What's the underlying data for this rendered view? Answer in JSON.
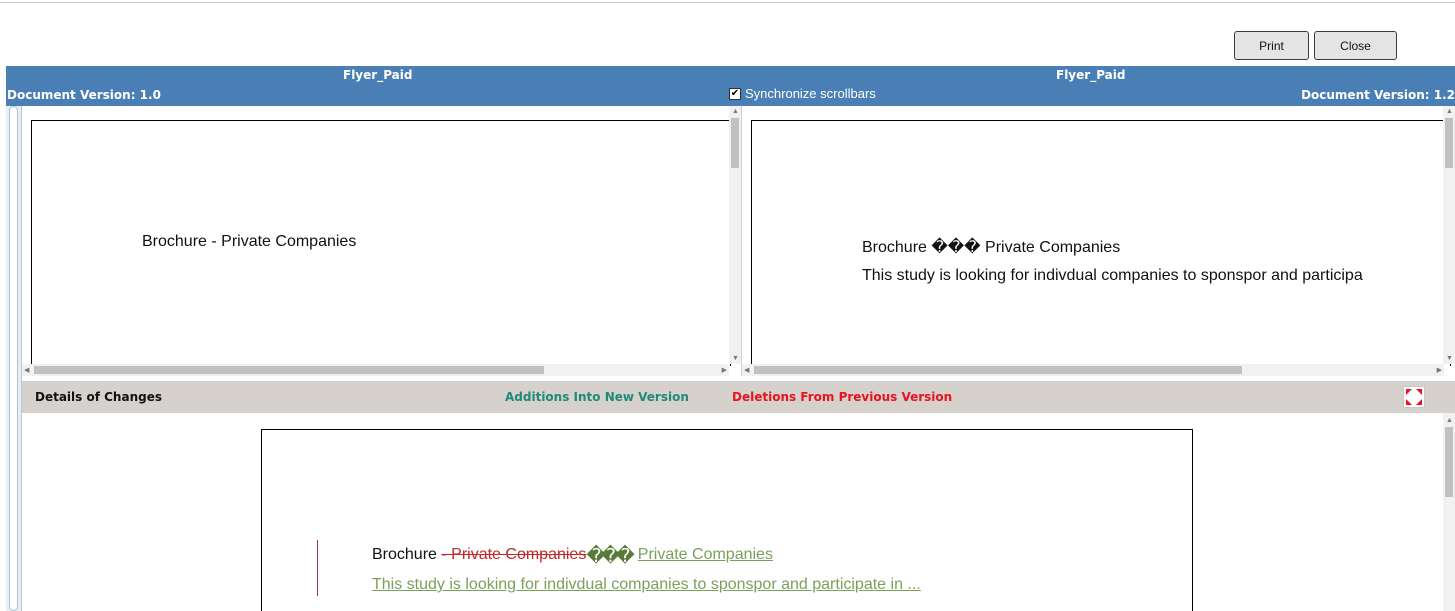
{
  "toolbar": {
    "print_label": "Print",
    "close_label": "Close"
  },
  "header": {
    "left": {
      "title": "Flyer_Paid",
      "version": "Document Version: 1.0"
    },
    "right": {
      "title": "Flyer_Paid",
      "version": "Document Version: 1.2"
    },
    "sync_label": "Synchronize scrollbars",
    "sync_checked": true
  },
  "left_doc": {
    "text": "Brochure - Private Companies"
  },
  "right_doc": {
    "line1": "Brochure ��� Private Companies",
    "line2": "This study is looking for indivdual companies to sponspor and participa"
  },
  "details": {
    "title": "Details of Changes",
    "additions_legend": "Additions Into New Version",
    "deletions_legend": "Deletions From Previous Version",
    "line1_prefix": "Brochure ",
    "line1_deleted": " - Private Companies",
    "line1_inserted_glyphs": "���",
    "line1_inserted": "Private Companies",
    "line2_inserted": "This study is looking for indivdual companies to sponspor and participate in ..."
  },
  "colors": {
    "header_bg": "#4a7fb5",
    "addition": "#1e8a78",
    "deletion": "#e8131c",
    "inserted_text": "#7aa05a",
    "deleted_text": "#c0282a",
    "change_bar": "#9a3452"
  }
}
